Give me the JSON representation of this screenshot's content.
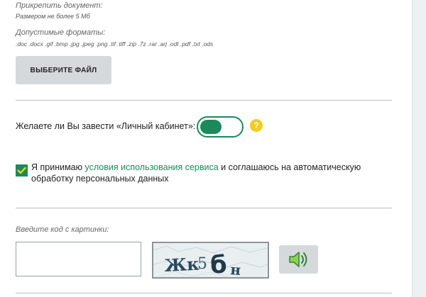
{
  "attach": {
    "label": "Прикрепить документ:",
    "size_note": "Размером не более 5 Мб",
    "formats_label": "Допустимые форматы:",
    "formats_list": ".doc .docx .gif .bmp .jpg .jpeg .png .tif .tiff .zip .7z .rar .arj .odt .pdf .txt .ods",
    "button_label": "ВЫБЕРИТЕ ФАЙЛ"
  },
  "cabinet": {
    "question": "Желаете ли Вы завести «Личный кабинет»:",
    "toggle_state": "on",
    "help_glyph": "?"
  },
  "consent": {
    "checked": true,
    "text_before": "Я принимаю ",
    "link_text": "условия использования сервиса",
    "text_after": " и соглашаюсь на автоматическую обработку персональных данных"
  },
  "captcha": {
    "label": "Введите код с картинки:",
    "input_value": "",
    "image_text": "Жк5бн",
    "audio_icon": "speaker-icon"
  },
  "colors": {
    "accent": "#1b8a5a",
    "help": "#f2cc1e",
    "button_bg": "#d5d9dc",
    "divider": "#b9bfc3"
  }
}
